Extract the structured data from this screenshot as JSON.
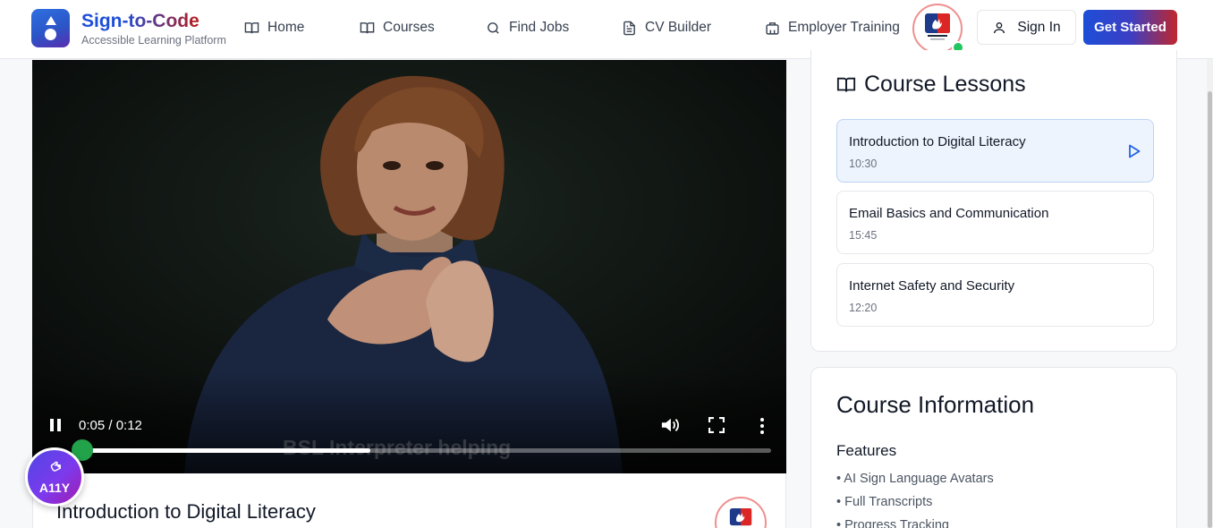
{
  "brand": {
    "title": "Sign-to-Code",
    "subtitle": "Accessible Learning Platform",
    "colors": {
      "blue": "#1d4ed8",
      "red": "#b91c1c",
      "purple": "#5b2db0"
    }
  },
  "nav": [
    {
      "label": "Home",
      "icon": "book-open-icon"
    },
    {
      "label": "Courses",
      "icon": "book-open-icon"
    },
    {
      "label": "Find Jobs",
      "icon": "search-icon"
    },
    {
      "label": "CV Builder",
      "icon": "document-icon"
    },
    {
      "label": "Employer Training",
      "icon": "building-icon"
    }
  ],
  "header": {
    "signin_label": "Sign In",
    "get_started_label": "Get Started",
    "online_color": "#22c55e"
  },
  "video": {
    "caption": "BSL Interpreter helping",
    "time": "0:05 / 0:12",
    "progress": 0.42
  },
  "lesson": {
    "title": "Introduction to Digital Literacy"
  },
  "a11y": {
    "label": "A11Y"
  },
  "lessons_panel": {
    "heading": "Course Lessons",
    "items": [
      {
        "title": "Introduction to Digital Literacy",
        "duration": "10:30",
        "active": true
      },
      {
        "title": "Email Basics and Communication",
        "duration": "15:45",
        "active": false
      },
      {
        "title": "Internet Safety and Security",
        "duration": "12:20",
        "active": false
      }
    ]
  },
  "info_panel": {
    "heading": "Course Information",
    "features_heading": "Features",
    "features": [
      "• AI Sign Language Avatars",
      "• Full Transcripts",
      "• Progress Tracking"
    ]
  }
}
